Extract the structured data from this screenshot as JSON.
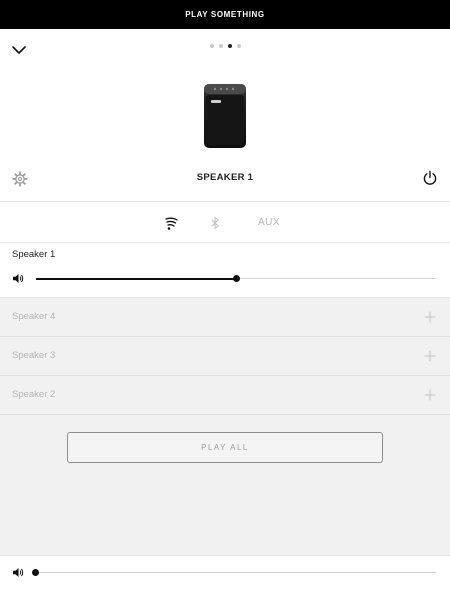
{
  "topbar": {
    "title": "PLAY SOMETHING"
  },
  "header": {
    "chevron_icon": "chevron-down-icon",
    "page_dots": {
      "count": 4,
      "active_index": 2
    },
    "speaker_image": "speaker-image",
    "speaker_name": "SPEAKER 1",
    "settings_icon": "gear-icon",
    "power_icon": "power-icon"
  },
  "sources": {
    "wifi_icon": "wifi-icon",
    "bluetooth_icon": "bluetooth-icon",
    "aux_label": "AUX"
  },
  "active_speaker": {
    "name": "Speaker 1",
    "volume_icon": "volume-icon",
    "volume_fraction": 0.5
  },
  "other_speakers": [
    {
      "name": "Speaker 4",
      "action_icon": "plus-icon"
    },
    {
      "name": "Speaker 3",
      "action_icon": "plus-icon"
    },
    {
      "name": "Speaker 2",
      "action_icon": "plus-icon"
    }
  ],
  "play_all_label": "PLAY ALL",
  "master_volume": {
    "volume_icon": "volume-icon",
    "volume_fraction": 0.0
  },
  "colors": {
    "topbar_bg": "#000000",
    "group_bg": "#f1f1f1",
    "inactive_text": "#b3b3b3",
    "slider_fill": "#111111"
  }
}
